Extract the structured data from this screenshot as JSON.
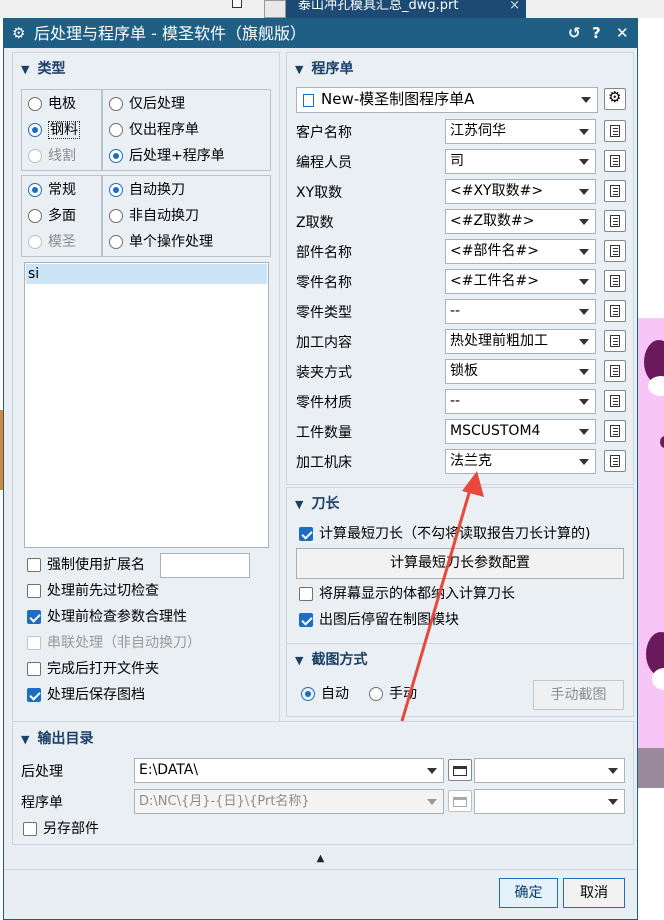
{
  "background": {
    "tab_title": "泰山冲孔模具汇总_dwg.prt",
    "tab_close": "×"
  },
  "dialog": {
    "title": "后处理与程序单 - 模圣软件（旗舰版）",
    "gear_glyph": "⚙",
    "reset_glyph": "↺",
    "help_glyph": "?",
    "close_glyph": "✕"
  },
  "type_section": {
    "header": "类型",
    "group1": [
      "电极",
      "钢料",
      "线割"
    ],
    "group1_selected": "钢料",
    "group2": [
      "仅后处理",
      "仅出程序单",
      "后处理+程序单"
    ],
    "group2_selected": "后处理+程序单",
    "group3": [
      "常规",
      "多面",
      "模圣"
    ],
    "group3_selected": "常规",
    "group4": [
      "自动换刀",
      "非自动换刀",
      "单个操作处理"
    ],
    "group4_selected": "自动换刀",
    "list_items": [
      "si"
    ],
    "force_ext": {
      "label": "强制使用扩展名",
      "checked": false,
      "value": ""
    },
    "options": [
      {
        "label": "处理前先过切检查",
        "checked": false
      },
      {
        "label": "处理前检查参数合理性",
        "checked": true
      },
      {
        "label": "串联处理（非自动换刀）",
        "checked": false,
        "disabled": true
      },
      {
        "label": "完成后打开文件夹",
        "checked": false
      },
      {
        "label": "处理后保存图档",
        "checked": true
      }
    ]
  },
  "program_sheet": {
    "header": "程序单",
    "template": "New-模圣制图程序单A",
    "rows": [
      {
        "label": "客户名称",
        "value": "江苏伺华"
      },
      {
        "label": "编程人员",
        "value": "司"
      },
      {
        "label": "XY取数",
        "value": "<#XY取数#>"
      },
      {
        "label": "Z取数",
        "value": "<#Z取数#>"
      },
      {
        "label": "部件名称",
        "value": "<#部件名#>"
      },
      {
        "label": "零件名称",
        "value": "<#工件名#>"
      },
      {
        "label": "零件类型",
        "value": "--"
      },
      {
        "label": "加工内容",
        "value": "热处理前粗加工"
      },
      {
        "label": "装夹方式",
        "value": "锁板"
      },
      {
        "label": "零件材质",
        "value": "--"
      },
      {
        "label": "工件数量",
        "value": "MSCUSTOM4"
      },
      {
        "label": "加工机床",
        "value": "法兰克"
      }
    ]
  },
  "tool_length": {
    "header": "刀长",
    "calc_shortest": {
      "label": "计算最短刀长（不勾将读取报告刀长计算的)",
      "checked": true
    },
    "config_button": "计算最短刀长参数配置",
    "include_screen": {
      "label": "将屏幕显示的体都纳入计算刀长",
      "checked": false
    },
    "stay_drawing": {
      "label": "出图后停留在制图模块",
      "checked": true
    }
  },
  "screenshot": {
    "header": "截图方式",
    "options": [
      "自动",
      "手动"
    ],
    "selected": "自动",
    "manual_button": "手动截图"
  },
  "output_dir": {
    "header": "输出目录",
    "post_label": "后处理",
    "post_path": "E:\\DATA\\",
    "sheet_label": "程序单",
    "sheet_path": "D:\\NC\\{月}-{日}\\{Prt名称}",
    "save_part": {
      "label": "另存部件",
      "checked": false
    }
  },
  "footer": {
    "collapse_glyph": "▲",
    "ok": "确定",
    "cancel": "取消"
  },
  "colors": {
    "titlebar": "#1f5f86",
    "accent": "#1b6ec2",
    "annotation_arrow": "#e8473b"
  }
}
